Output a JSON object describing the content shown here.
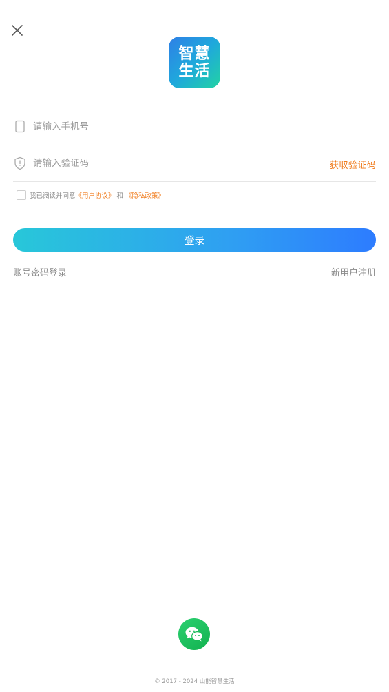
{
  "header": {
    "close_icon": "close-icon"
  },
  "logo": {
    "line1": "智慧",
    "line2": "生活",
    "colors": [
      "#2f7fe6",
      "#1fa8dc",
      "#22d3a3"
    ]
  },
  "form": {
    "phone": {
      "placeholder": "请输入手机号",
      "icon": "phone-icon"
    },
    "code": {
      "placeholder": "请输入验证码",
      "icon": "shield-icon",
      "get_code_label": "获取验证码"
    }
  },
  "agreement": {
    "prefix": "我已阅读并同意",
    "user_agreement": "《用户协议》",
    "and": "和",
    "privacy_policy": "《隐私政策》",
    "checked": false
  },
  "login_button": {
    "label": "登录",
    "gradient": [
      "#28c7d9",
      "#2d7cff"
    ]
  },
  "links": {
    "password_login": "账号密码登录",
    "register": "新用户注册"
  },
  "wechat": {
    "icon": "wechat-icon",
    "color": "#12b24f"
  },
  "footer": {
    "copyright": "© 2017 - 2024 山能智慧生活"
  },
  "accent_color": "#f07a1a"
}
